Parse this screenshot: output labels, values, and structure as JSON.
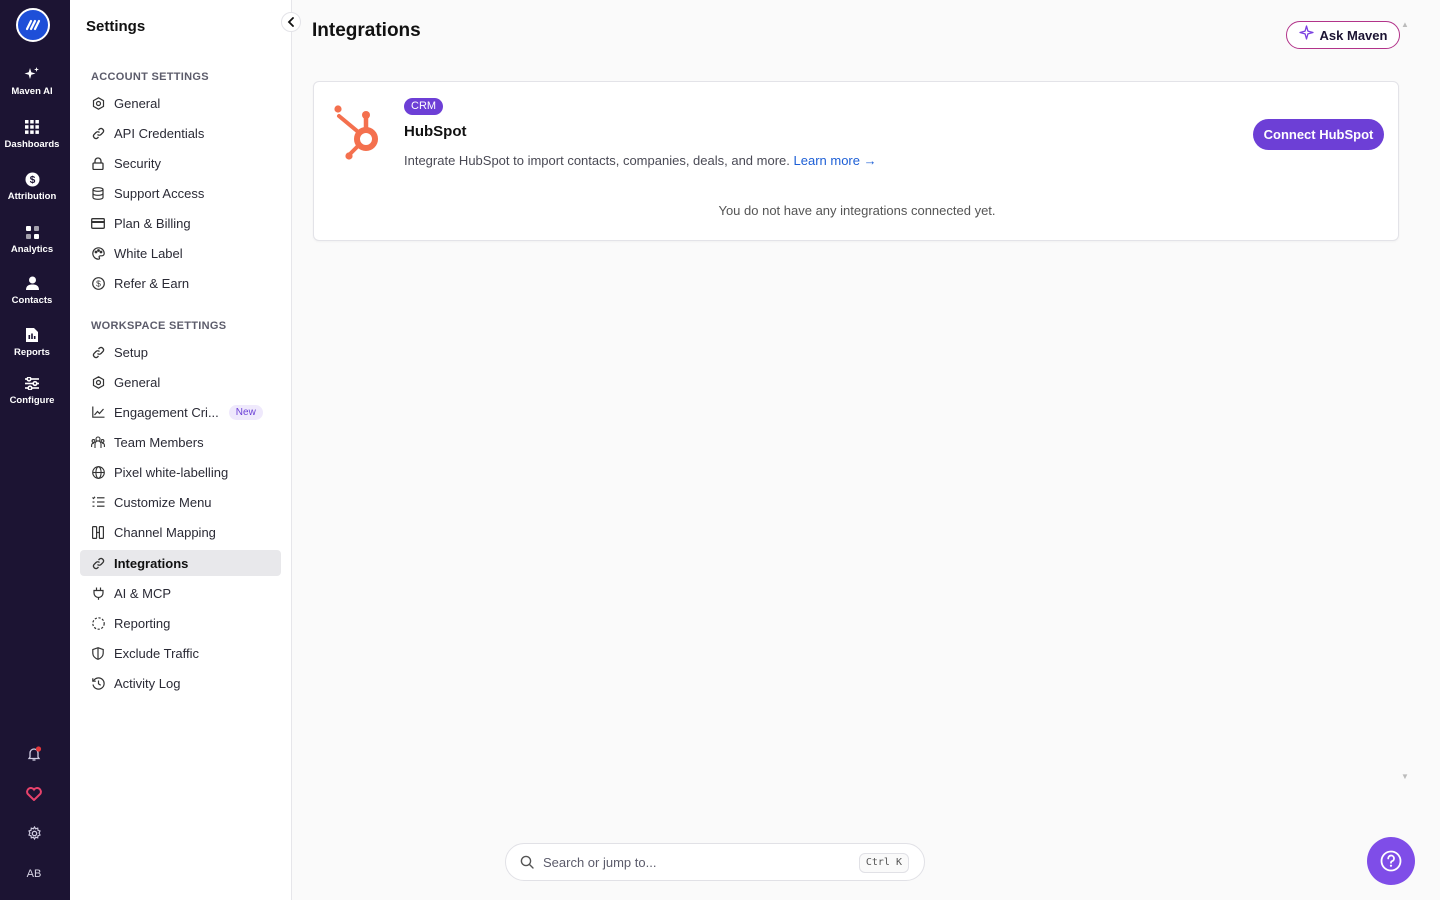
{
  "rail": {
    "items": [
      {
        "label": "Maven AI",
        "icon": "sparkles-icon"
      },
      {
        "label": "Dashboards",
        "icon": "grid-icon"
      },
      {
        "label": "Attribution",
        "icon": "dollar-circle-icon"
      },
      {
        "label": "Analytics",
        "icon": "analytics-icon"
      },
      {
        "label": "Contacts",
        "icon": "person-icon"
      },
      {
        "label": "Reports",
        "icon": "document-icon"
      },
      {
        "label": "Configure",
        "icon": "sliders-icon"
      }
    ],
    "avatar_initials": "AB",
    "notification_color": "#e5373b",
    "heart_color": "#e8426b"
  },
  "sidebar": {
    "title": "Settings",
    "account_section_label": "ACCOUNT SETTINGS",
    "account_items": [
      {
        "label": "General",
        "icon": "hexagon-gear-icon"
      },
      {
        "label": "API Credentials",
        "icon": "link-icon"
      },
      {
        "label": "Security",
        "icon": "lock-icon"
      },
      {
        "label": "Support Access",
        "icon": "database-icon"
      },
      {
        "label": "Plan & Billing",
        "icon": "credit-card-icon"
      },
      {
        "label": "White Label",
        "icon": "palette-icon"
      },
      {
        "label": "Refer & Earn",
        "icon": "dollar-circle-icon"
      }
    ],
    "workspace_section_label": "WORKSPACE SETTINGS",
    "workspace_items": [
      {
        "label": "Setup",
        "icon": "link-icon"
      },
      {
        "label": "General",
        "icon": "hexagon-gear-icon"
      },
      {
        "label": "Engagement Cri...",
        "icon": "line-chart-icon",
        "badge": "New"
      },
      {
        "label": "Team Members",
        "icon": "team-icon"
      },
      {
        "label": "Pixel white-labelling",
        "icon": "globe-icon"
      },
      {
        "label": "Customize Menu",
        "icon": "list-check-icon"
      },
      {
        "label": "Channel Mapping",
        "icon": "columns-icon"
      },
      {
        "label": "Integrations",
        "icon": "link-icon",
        "active": true
      },
      {
        "label": "AI & MCP",
        "icon": "plug-icon"
      },
      {
        "label": "Reporting",
        "icon": "dashed-circle-icon"
      },
      {
        "label": "Exclude Traffic",
        "icon": "shield-icon"
      },
      {
        "label": "Activity Log",
        "icon": "history-icon"
      }
    ]
  },
  "header": {
    "title": "Integrations",
    "ask_button_label": "Ask Maven"
  },
  "integration": {
    "badge": "CRM",
    "name": "HubSpot",
    "description": "Integrate HubSpot to import contacts, companies, deals, and more.",
    "learn_more": "Learn more →",
    "connect_label": "Connect HubSpot",
    "empty_message": "You do not have any integrations connected yet.",
    "brand_color": "#f4704e"
  },
  "search": {
    "placeholder": "Search or jump to...",
    "shortcut": "Ctrl K"
  },
  "colors": {
    "accent": "#6d3fd6",
    "rail_bg": "#1c1433"
  }
}
